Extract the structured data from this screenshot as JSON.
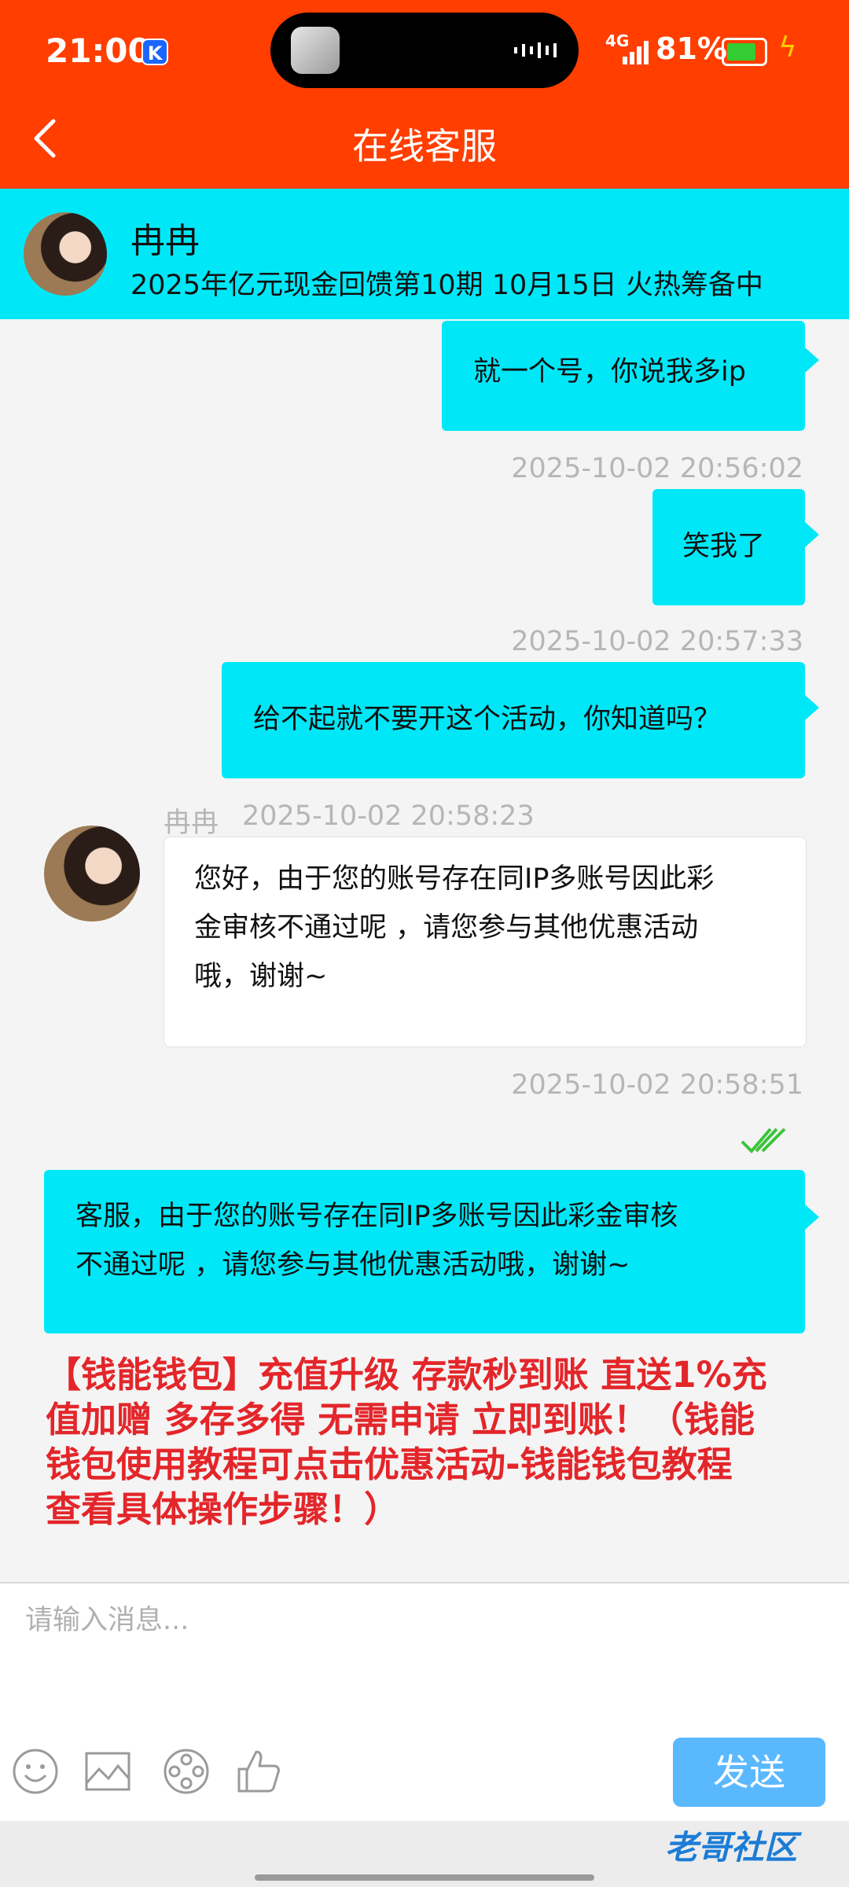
{
  "status_bar": {
    "time": "21:00",
    "notification_badge": "K",
    "network": "4G",
    "battery_percent": "81%",
    "battery_level": 0.81
  },
  "header": {
    "title": "在线客服"
  },
  "agent": {
    "name": "冉冉",
    "notice": "2025年亿元现金回馈第10期 10月15日 火热筹备中"
  },
  "messages": {
    "m1": {
      "text": "就一个号，你说我多ip"
    },
    "m2": {
      "timestamp": "2025-10-02 20:56:02",
      "text": "笑我了"
    },
    "m3": {
      "timestamp": "2025-10-02 20:57:33",
      "text": "给不起就不要开这个活动，你知道吗？"
    },
    "m4": {
      "sender": "冉冉",
      "timestamp": "2025-10-02 20:58:23",
      "line1": "您好，由于您的账号存在同IP多账号因此彩",
      "line2": "金审核不通过呢 ，请您参与其他优惠活动",
      "line3": "哦，谢谢~"
    },
    "m5": {
      "timestamp": "2025-10-02 20:58:51",
      "line1": "客服，由于您的账号存在同IP多账号因此彩金审核",
      "line2": "不通过呢 ，请您参与其他优惠活动哦，谢谢~"
    }
  },
  "promo": {
    "line1": "【钱能钱包】充值升级 存款秒到账 直送1%充",
    "line2": "值加赠 多存多得  无需申请 立即到账！（钱能",
    "line3": "钱包使用教程可点击优惠活动-钱能钱包教程",
    "line4": "查看具体操作步骤！）"
  },
  "composer": {
    "placeholder": "请输入消息...",
    "send_label": "发送",
    "tools": [
      "emoji-icon",
      "image-icon",
      "film-reel-icon",
      "thumbs-up-icon"
    ]
  },
  "watermark": "老哥社区",
  "colors": {
    "header": "#ff3e00",
    "banner": "#00e8f8",
    "outgoing_bubble": "#00e8f8",
    "send_button": "#5ab8ff",
    "promo_text": "#e3262a",
    "read_check": "#3cc43c"
  }
}
